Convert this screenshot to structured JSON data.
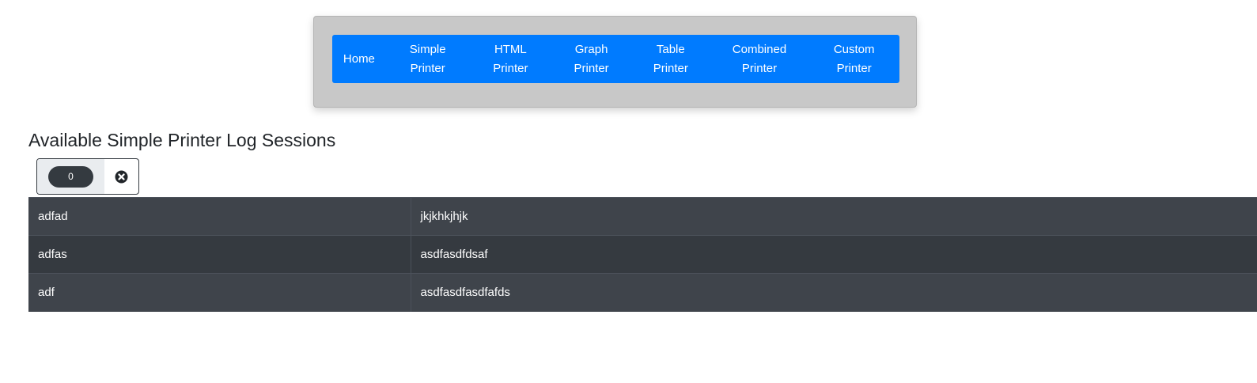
{
  "nav": {
    "items": [
      {
        "label": "Home"
      },
      {
        "label": "Simple\nPrinter"
      },
      {
        "label": "HTML\nPrinter"
      },
      {
        "label": "Graph\nPrinter"
      },
      {
        "label": "Table\nPrinter"
      },
      {
        "label": "Combined\nPrinter"
      },
      {
        "label": "Custom\nPrinter"
      }
    ]
  },
  "page": {
    "heading": "Available Simple Printer Log Sessions"
  },
  "counter": {
    "value": "0",
    "clear_icon": "times-circle-icon"
  },
  "sessions": {
    "rows": [
      {
        "name": "adfad",
        "value": "jkjkhkjhjk"
      },
      {
        "name": "adfas",
        "value": "asdfasdfdsaf"
      },
      {
        "name": "adf",
        "value": "asdfasdfasdfafds"
      }
    ]
  },
  "colors": {
    "nav_accent": "#007bff",
    "nav_card": "#c8c8c8",
    "table_dark": "#343a40"
  }
}
